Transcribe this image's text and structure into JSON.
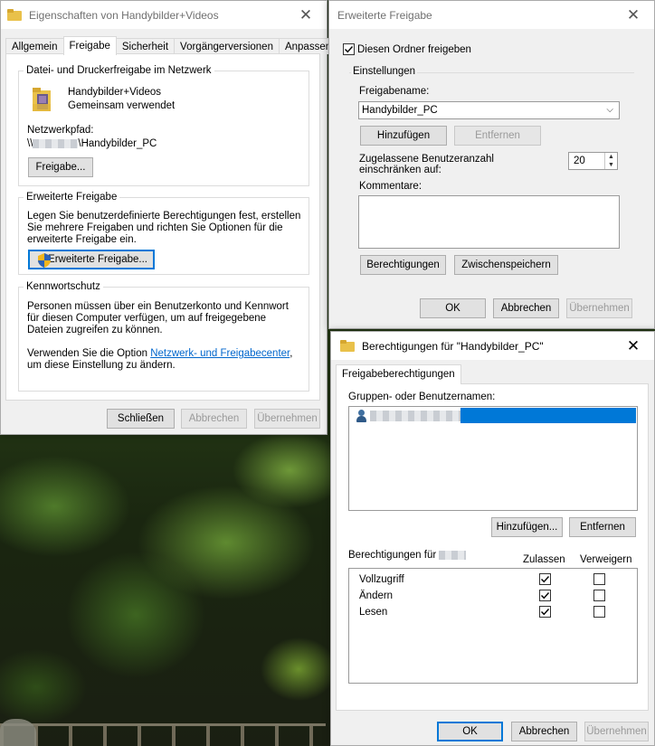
{
  "window_properties": {
    "title": "Eigenschaften von Handybilder+Videos",
    "tabs": [
      "Allgemein",
      "Freigabe",
      "Sicherheit",
      "Vorgängerversionen",
      "Anpassen"
    ],
    "selected_tab": "Freigabe",
    "network_section": {
      "legend": "Datei- und Druckerfreigabe im Netzwerk",
      "folder_name": "Handybilder+Videos",
      "folder_status": "Gemeinsam verwendet",
      "network_path_label": "Netzwerkpfad:",
      "network_path_prefix": "\\\\",
      "network_path_suffix": "\\Handybilder_PC",
      "share_button": "Freigabe..."
    },
    "advanced_section": {
      "legend": "Erweiterte Freigabe",
      "description": "Legen Sie benutzerdefinierte Berechtigungen fest, erstellen Sie mehrere Freigaben und richten Sie Optionen für die erweiterte Freigabe ein.",
      "button": "Erweiterte Freigabe..."
    },
    "password_section": {
      "legend": "Kennwortschutz",
      "description": "Personen müssen über ein Benutzerkonto und Kennwort für diesen Computer verfügen, um auf freigegebene Dateien zugreifen zu können.",
      "text_before_link": "Verwenden Sie die Option ",
      "link": "Netzwerk- und Freigabecenter",
      "text_after_link": ", um diese Einstellung zu ändern."
    },
    "buttons": {
      "close": "Schließen",
      "cancel": "Abbrechen",
      "apply": "Übernehmen"
    }
  },
  "window_advanced": {
    "title": "Erweiterte Freigabe",
    "share_checkbox_label": "Diesen Ordner freigeben",
    "share_checked": true,
    "settings_legend": "Einstellungen",
    "share_name_label": "Freigabename:",
    "share_name_value": "Handybilder_PC",
    "add_button": "Hinzufügen",
    "remove_button": "Entfernen",
    "user_limit_label": "Zugelassene Benutzeranzahl einschränken auf:",
    "user_limit_value": "20",
    "comments_label": "Kommentare:",
    "permissions_button": "Berechtigungen",
    "caching_button": "Zwischenspeichern",
    "buttons": {
      "ok": "OK",
      "cancel": "Abbrechen",
      "apply": "Übernehmen"
    }
  },
  "window_permissions": {
    "title": "Berechtigungen für \"Handybilder_PC\"",
    "tab": "Freigabeberechtigungen",
    "groups_label": "Gruppen- oder Benutzernamen:",
    "add_button": "Hinzufügen...",
    "remove_button": "Entfernen",
    "permissions_for_label": "Berechtigungen für",
    "col_allow": "Zulassen",
    "col_deny": "Verweigern",
    "permissions": [
      {
        "name": "Vollzugriff",
        "allow": true,
        "deny": false
      },
      {
        "name": "Ändern",
        "allow": true,
        "deny": false
      },
      {
        "name": "Lesen",
        "allow": true,
        "deny": false
      }
    ],
    "buttons": {
      "ok": "OK",
      "cancel": "Abbrechen",
      "apply": "Übernehmen"
    }
  },
  "colors": {
    "accent": "#0078d7",
    "link": "#0066cc",
    "selection": "#0078d7"
  },
  "icons": [
    "folder-icon",
    "close-icon",
    "shield-icon",
    "user-icon",
    "checkmark-icon",
    "chevron-down-icon"
  ]
}
